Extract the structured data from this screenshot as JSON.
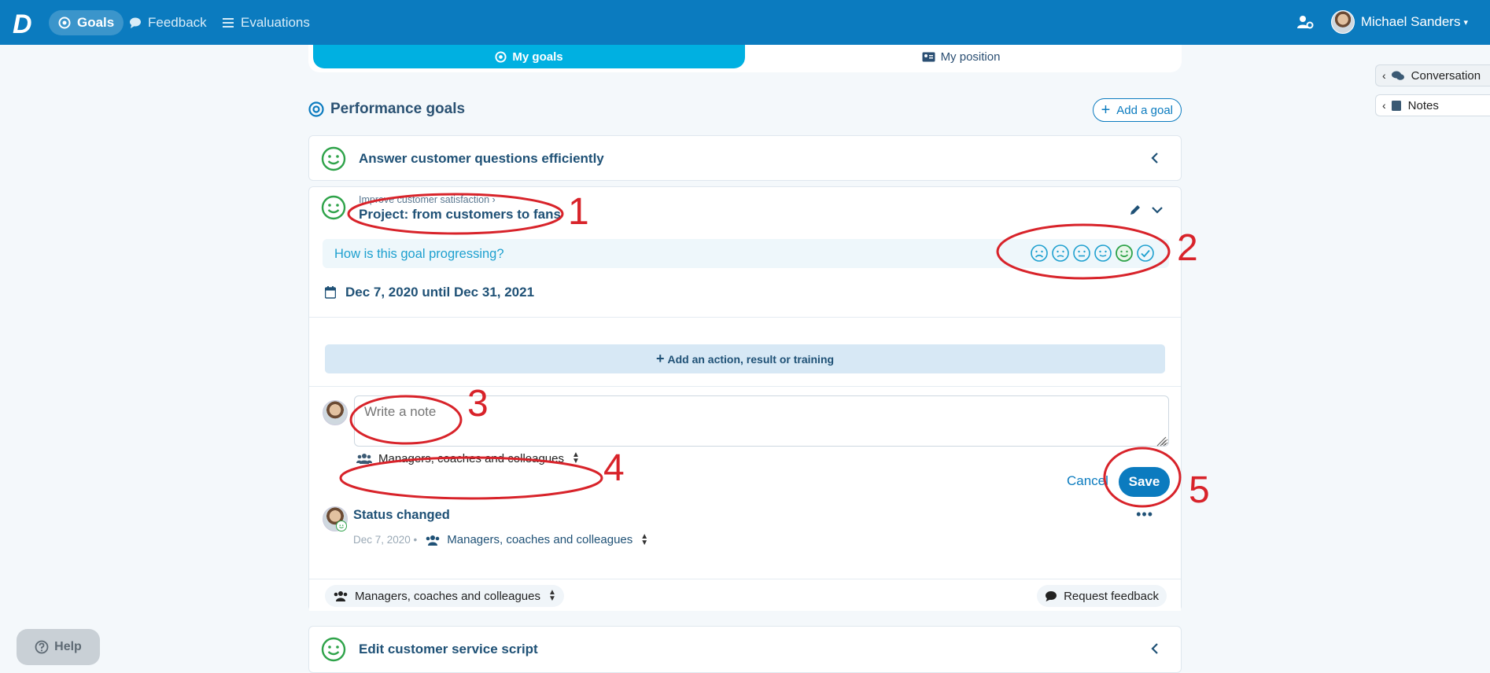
{
  "topbar": {
    "logo_letter": "D",
    "nav": [
      {
        "label": "Goals",
        "icon": "target-icon",
        "active": true
      },
      {
        "label": "Feedback",
        "icon": "chat-bubble-icon",
        "active": false
      },
      {
        "label": "Evaluations",
        "icon": "list-icon",
        "active": false
      }
    ],
    "user_name": "Michael Sanders"
  },
  "tabs": {
    "my_goals": "My goals",
    "my_position": "My position"
  },
  "section": {
    "title": "Performance goals",
    "add_goal": "Add a goal"
  },
  "goals": {
    "first": "Answer customer questions efficiently",
    "expanded": {
      "breadcrumb": "Improve customer satisfaction ›",
      "title": "Project: from customers to fans",
      "progress_question": "How is this goal progressing?",
      "date_range": "Dec 7, 2020 until Dec 31, 2021",
      "add_action": "Add an action, result or training",
      "note_placeholder": "Write a note",
      "visibility": "Managers, coaches and colleagues",
      "cancel": "Cancel",
      "save": "Save",
      "status": {
        "title": "Status changed",
        "date": "Dec 7, 2020 •",
        "visibility": "Managers, coaches and colleagues"
      },
      "footer_visibility": "Managers, coaches and colleagues",
      "request_feedback": "Request feedback"
    },
    "last": "Edit customer service script"
  },
  "side": {
    "conversation": "Conversation",
    "notes": "Notes"
  },
  "help": "Help",
  "annotations": [
    "1",
    "2",
    "3",
    "4",
    "5"
  ],
  "colors": {
    "primary": "#0b7bbf",
    "accent": "#00b0e1",
    "annotation": "#d8232a",
    "smile_green": "#2fa34a"
  }
}
